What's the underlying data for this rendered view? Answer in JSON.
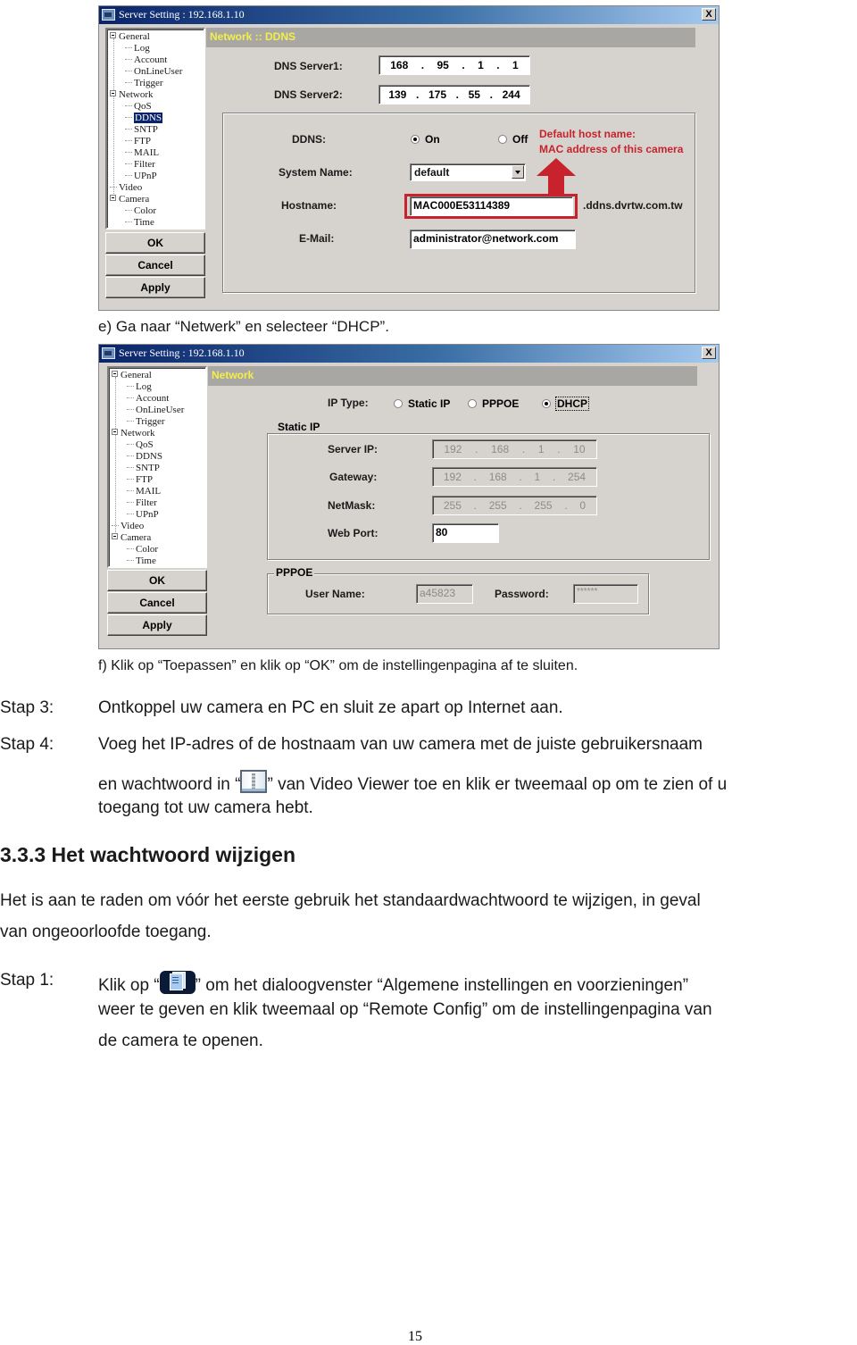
{
  "window1": {
    "title": "Server Setting : 192.168.1.10",
    "close_label": "X",
    "tree": [
      {
        "label": "General",
        "level": 0,
        "expander": true
      },
      {
        "label": "Log",
        "level": 1
      },
      {
        "label": "Account",
        "level": 1
      },
      {
        "label": "OnLineUser",
        "level": 1
      },
      {
        "label": "Trigger",
        "level": 1
      },
      {
        "label": "Network",
        "level": 0,
        "expander": true
      },
      {
        "label": "QoS",
        "level": 1
      },
      {
        "label": "DDNS",
        "level": 1,
        "selected": true
      },
      {
        "label": "SNTP",
        "level": 1
      },
      {
        "label": "FTP",
        "level": 1
      },
      {
        "label": "MAIL",
        "level": 1
      },
      {
        "label": "Filter",
        "level": 1
      },
      {
        "label": "UPnP",
        "level": 1
      },
      {
        "label": "Video",
        "level": 0
      },
      {
        "label": "Camera",
        "level": 0,
        "expander": true
      },
      {
        "label": "Color",
        "level": 1
      },
      {
        "label": "Time",
        "level": 1
      }
    ],
    "buttons": {
      "ok": "OK",
      "cancel": "Cancel",
      "apply": "Apply"
    },
    "panel_title": "Network :: DDNS",
    "dns1": {
      "label": "DNS Server1:",
      "octets": [
        "168",
        "95",
        "1",
        "1"
      ]
    },
    "dns2": {
      "label": "DNS Server2:",
      "octets": [
        "139",
        "175",
        "55",
        "244"
      ]
    },
    "ddns": {
      "label": "DDNS:",
      "on_label": "On",
      "off_label": "Off",
      "selected": "On"
    },
    "system_name": {
      "label": "System Name:",
      "value": "default"
    },
    "hostname": {
      "label": "Hostname:",
      "value": "MAC000E53114389",
      "suffix": ".ddns.dvrtw.com.tw"
    },
    "email": {
      "label": "E-Mail:",
      "value": "administrator@network.com"
    },
    "annotation": {
      "line1": "Default host name:",
      "line2": "MAC address of this camera",
      "color": "#c8222c"
    }
  },
  "caption_e": "e)  Ga naar “Netwerk” en selecteer “DHCP”.",
  "window2": {
    "title": "Server Setting : 192.168.1.10",
    "close_label": "X",
    "tree": [
      {
        "label": "General",
        "level": 0,
        "expander": true
      },
      {
        "label": "Log",
        "level": 1
      },
      {
        "label": "Account",
        "level": 1
      },
      {
        "label": "OnLineUser",
        "level": 1
      },
      {
        "label": "Trigger",
        "level": 1
      },
      {
        "label": "Network",
        "level": 0,
        "expander": true
      },
      {
        "label": "QoS",
        "level": 1
      },
      {
        "label": "DDNS",
        "level": 1
      },
      {
        "label": "SNTP",
        "level": 1
      },
      {
        "label": "FTP",
        "level": 1
      },
      {
        "label": "MAIL",
        "level": 1
      },
      {
        "label": "Filter",
        "level": 1
      },
      {
        "label": "UPnP",
        "level": 1
      },
      {
        "label": "Video",
        "level": 0
      },
      {
        "label": "Camera",
        "level": 0,
        "expander": true
      },
      {
        "label": "Color",
        "level": 1
      },
      {
        "label": "Time",
        "level": 1
      }
    ],
    "buttons": {
      "ok": "OK",
      "cancel": "Cancel",
      "apply": "Apply"
    },
    "panel_title": "Network",
    "ip_type": {
      "label": "IP Type:",
      "options": [
        "Static IP",
        "PPPOE",
        "DHCP"
      ],
      "selected": "DHCP"
    },
    "static_ip": {
      "group_label": "Static IP",
      "server_ip": {
        "label": "Server IP:",
        "octets": [
          "192",
          "168",
          "1",
          "10"
        ]
      },
      "gateway": {
        "label": "Gateway:",
        "octets": [
          "192",
          "168",
          "1",
          "254"
        ]
      },
      "netmask": {
        "label": "NetMask:",
        "octets": [
          "255",
          "255",
          "255",
          "0"
        ]
      },
      "web_port": {
        "label": "Web Port:",
        "value": "80"
      }
    },
    "pppoe": {
      "group_label": "PPPOE",
      "user_name": {
        "label": "User Name:",
        "value": "a45823"
      },
      "password": {
        "label": "Password:",
        "value": "******"
      }
    }
  },
  "caption_f": "f)  Klik op “Toepassen” en klik op “OK” om de instellingenpagina af te sluiten.",
  "steps_a": [
    {
      "label": "Stap 3:",
      "text": "Ontkoppel uw camera en PC en sluit ze apart op Internet aan."
    },
    {
      "label": "Stap 4:",
      "line1": "Voeg het IP-adres of de hostnaam van uw camera met de juiste gebruikersnaam",
      "line2_before": "en wachtwoord in “",
      "line2_icon": "address-book-icon",
      "line2_after": "” van Video Viewer toe en klik er tweemaal op om te zien of u",
      "line3": "toegang tot uw camera hebt."
    }
  ],
  "section": {
    "heading": "3.3.3 Het wachtwoord wijzigen",
    "para_line1": "Het is aan te raden om vóór het eerste gebruik het standaardwachtwoord te wijzigen, in geval",
    "para_line2": "van ongeoorloofde toegang.",
    "step1": {
      "label": "Stap 1:",
      "line1_before": "Klik op “",
      "line1_icon": "config-icon",
      "line1_after": "” om het dialoogvenster “Algemene instellingen en voorzieningen”",
      "line2": "weer te geven en klik tweemaal op “Remote Config” om de instellingenpagina van",
      "line3": "de camera te openen."
    }
  },
  "page_number": "15"
}
